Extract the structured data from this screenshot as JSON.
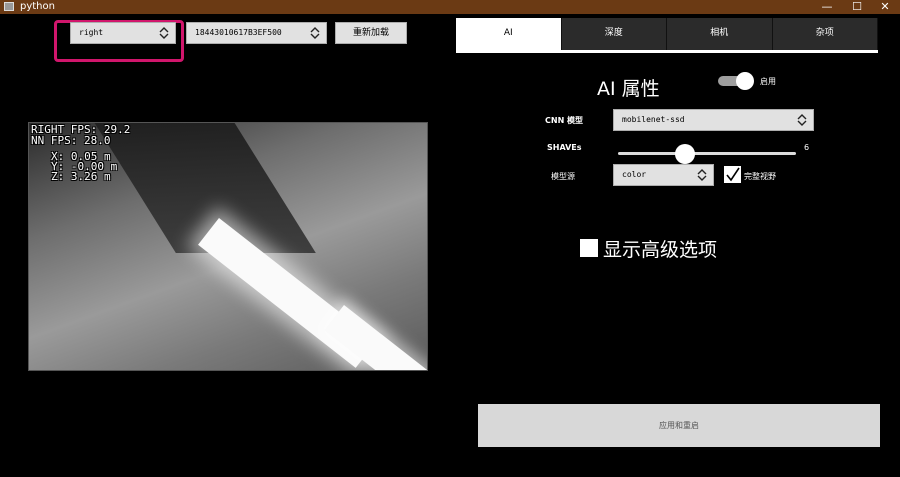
{
  "window": {
    "title": "python",
    "minimize": "—",
    "maximize": "☐",
    "close": "✕"
  },
  "toolbar": {
    "camera_select": "right",
    "device_select": "18443010617B3EF500",
    "reload_label": "重新加载"
  },
  "preview": {
    "overlay_lines": [
      "RIGHT FPS: 29.2",
      "NN FPS:   28.0",
      "X: 0.05 m",
      "Y: -0.00 m",
      "Z: 3.26 m"
    ]
  },
  "tabs": [
    {
      "label": "AI",
      "active": true
    },
    {
      "label": "深度",
      "active": false
    },
    {
      "label": "相机",
      "active": false
    },
    {
      "label": "杂项",
      "active": false
    }
  ],
  "ai_panel": {
    "heading": "AI 属性",
    "enable_label": "启用",
    "enabled": true,
    "cnn_label": "CNN 模型",
    "cnn_value": "mobilenet-ssd",
    "shaves_label": "SHAVEs",
    "shaves_value": "6",
    "shaves_fraction": 0.36,
    "source_label": "模型源",
    "source_value": "color",
    "full_fov_label": "完整视野",
    "full_fov_checked": true,
    "advanced_label": "显示高级选项",
    "advanced_checked": false
  },
  "footer": {
    "apply_label": "应用和重启"
  }
}
